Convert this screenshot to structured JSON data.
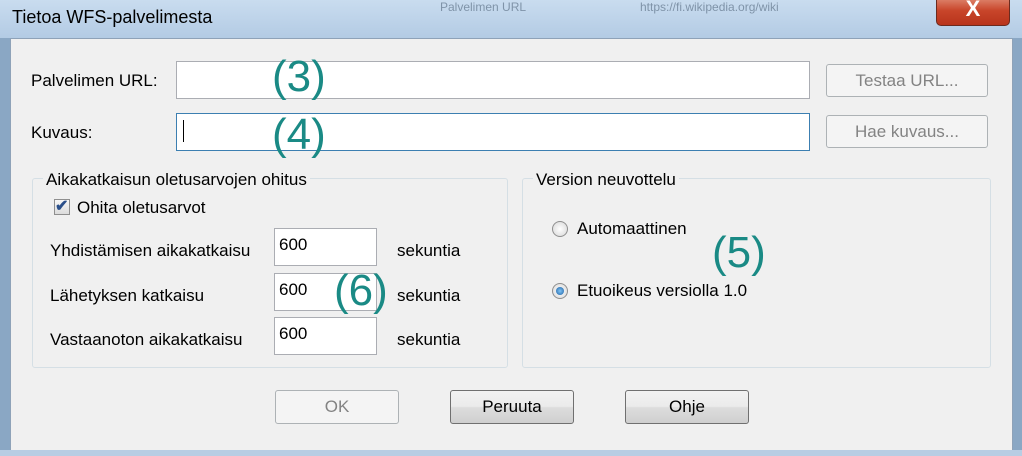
{
  "window": {
    "title": "Tietoa WFS-palvelimesta",
    "close_glyph": "X"
  },
  "background_ghost": {
    "left": "Palvelimen URL",
    "right": "https://fi.wikipedia.org/wiki"
  },
  "service_url": {
    "label": "Palvelimen URL:",
    "value": "",
    "test_button": "Testaa URL..."
  },
  "description": {
    "label": "Kuvaus:",
    "value": "",
    "fetch_button": "Hae kuvaus..."
  },
  "timeouts": {
    "group_title": "Aikakatkaisun oletusarvojen ohitus",
    "override_label": "Ohita oletusarvot",
    "override_checked": true,
    "rows": [
      {
        "label": "Yhdistämisen aikakatkaisu",
        "value": "600",
        "unit": "sekuntia"
      },
      {
        "label": "Lähetyksen katkaisu",
        "value": "600",
        "unit": "sekuntia"
      },
      {
        "label": "Vastaanoton aikakatkaisu",
        "value": "600",
        "unit": "sekuntia"
      }
    ]
  },
  "version": {
    "group_title": "Version neuvottelu",
    "options": [
      {
        "label": "Automaattinen",
        "selected": false
      },
      {
        "label": "Etuoikeus versiolla 1.0",
        "selected": true
      }
    ]
  },
  "buttons": {
    "ok": "OK",
    "cancel": "Peruuta",
    "help": "Ohje"
  },
  "annotations": [
    "(3)",
    "(4)",
    "(5)",
    "(6)"
  ],
  "colors": {
    "annotation": "#1a8a85",
    "titlebar": "#b9cfe6",
    "close_button": "#c8452a",
    "dialog": "#f0f0f0"
  }
}
